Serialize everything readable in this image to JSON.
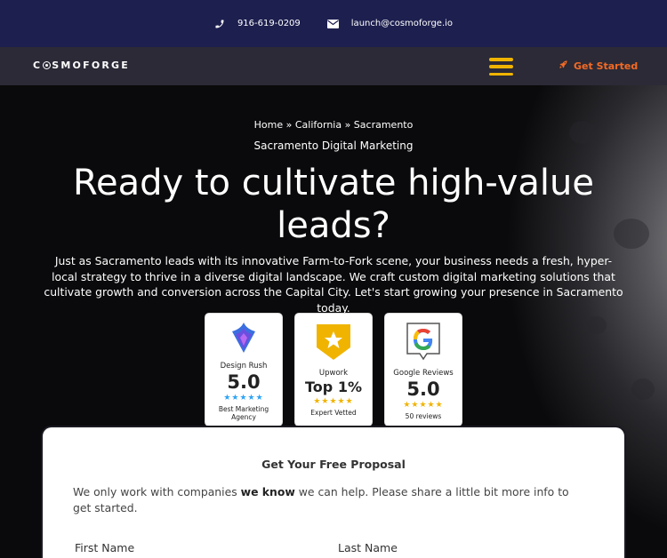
{
  "topbar": {
    "phone": "916-619-0209",
    "email": "launch@cosmoforge.io"
  },
  "nav": {
    "logo_pre": "C",
    "logo_post": "SMOFORGE",
    "cta": "Get Started"
  },
  "hero": {
    "breadcrumb": "Home » California » Sacramento",
    "subtitle": "Sacramento Digital Marketing",
    "headline": "Ready to cultivate high-value leads?",
    "intro": "Just as Sacramento leads with its innovative Farm-to-Fork scene, your business needs a fresh, hyper-local strategy to thrive in a diverse digital landscape. We craft custom digital marketing solutions that cultivate growth and conversion across the Capital City. Let's start growing your presence in Sacramento today."
  },
  "badges": [
    {
      "name": "Design Rush",
      "score": "5.0",
      "stars": "★★★★★",
      "foot": "Best Marketing Agency",
      "star_color": "#2ea3f2"
    },
    {
      "name": "Upwork",
      "score": "Top 1%",
      "stars": "★★★★★",
      "foot": "Expert Vetted",
      "star_color": "#f0b400"
    },
    {
      "name": "Google Reviews",
      "score": "5.0",
      "stars": "★★★★★",
      "foot": "50 reviews",
      "star_color": "#f0b400"
    }
  ],
  "form": {
    "title": "Get Your Free Proposal",
    "text_pre": "We only work with companies ",
    "text_bold": "we know",
    "text_post": " we can help. Please share a little bit more info to get started.",
    "first_name_label": "First Name",
    "last_name_label": "Last Name"
  },
  "colors": {
    "topbar": "#1d1f4f",
    "navbar": "#2b2a36",
    "accent_orange": "#f36a25",
    "hamburger": "#f0b400"
  }
}
